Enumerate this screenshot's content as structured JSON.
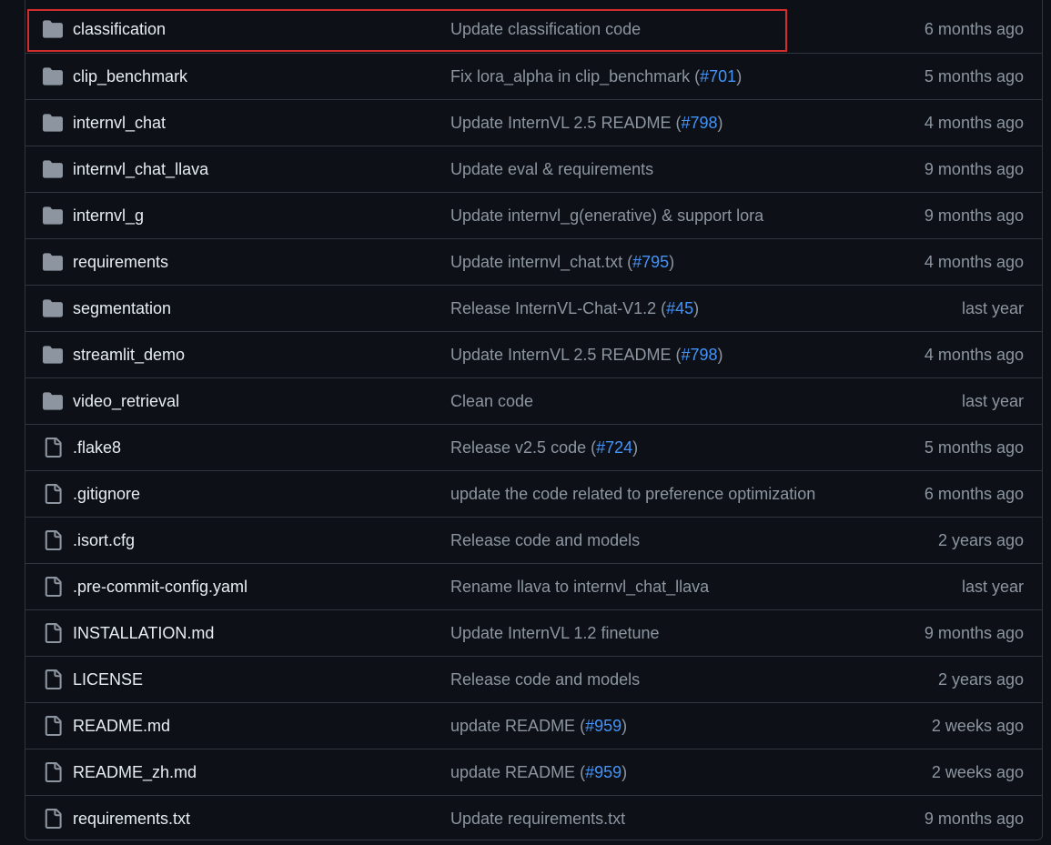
{
  "files": [
    {
      "type": "folder",
      "icon": "folder-icon",
      "name": "classification",
      "message": "Update classification code",
      "pr": "",
      "date": "6 months ago"
    },
    {
      "type": "folder",
      "icon": "folder-icon",
      "name": "clip_benchmark",
      "message": "Fix lora_alpha in clip_benchmark (",
      "pr": "#701",
      "date": "5 months ago"
    },
    {
      "type": "folder",
      "icon": "folder-icon",
      "name": "internvl_chat",
      "message": "Update InternVL 2.5 README (",
      "pr": "#798",
      "date": "4 months ago"
    },
    {
      "type": "folder",
      "icon": "folder-icon",
      "name": "internvl_chat_llava",
      "message": "Update eval & requirements",
      "pr": "",
      "date": "9 months ago"
    },
    {
      "type": "folder",
      "icon": "folder-icon",
      "name": "internvl_g",
      "message": "Update internvl_g(enerative) & support lora",
      "pr": "",
      "date": "9 months ago"
    },
    {
      "type": "folder",
      "icon": "folder-icon",
      "name": "requirements",
      "message": "Update internvl_chat.txt (",
      "pr": "#795",
      "date": "4 months ago"
    },
    {
      "type": "folder",
      "icon": "folder-icon",
      "name": "segmentation",
      "message": "Release InternVL-Chat-V1.2 (",
      "pr": "#45",
      "date": "last year"
    },
    {
      "type": "folder",
      "icon": "folder-icon",
      "name": "streamlit_demo",
      "message": "Update InternVL 2.5 README (",
      "pr": "#798",
      "date": "4 months ago"
    },
    {
      "type": "folder",
      "icon": "folder-icon",
      "name": "video_retrieval",
      "message": "Clean code",
      "pr": "",
      "date": "last year"
    },
    {
      "type": "file",
      "icon": "file-icon",
      "name": ".flake8",
      "message": "Release v2.5 code (",
      "pr": "#724",
      "date": "5 months ago"
    },
    {
      "type": "file",
      "icon": "file-icon",
      "name": ".gitignore",
      "message": "update the code related to preference optimization",
      "pr": "",
      "date": "6 months ago"
    },
    {
      "type": "file",
      "icon": "file-icon",
      "name": ".isort.cfg",
      "message": "Release code and models",
      "pr": "",
      "date": "2 years ago"
    },
    {
      "type": "file",
      "icon": "file-icon",
      "name": ".pre-commit-config.yaml",
      "message": "Rename llava to internvl_chat_llava",
      "pr": "",
      "date": "last year"
    },
    {
      "type": "file",
      "icon": "file-icon",
      "name": "INSTALLATION.md",
      "message": "Update InternVL 1.2 finetune",
      "pr": "",
      "date": "9 months ago"
    },
    {
      "type": "file",
      "icon": "file-icon",
      "name": "LICENSE",
      "message": "Release code and models",
      "pr": "",
      "date": "2 years ago"
    },
    {
      "type": "file",
      "icon": "file-icon",
      "name": "README.md",
      "message": "update README (",
      "pr": "#959",
      "date": "2 weeks ago"
    },
    {
      "type": "file",
      "icon": "file-icon",
      "name": "README_zh.md",
      "message": "update README (",
      "pr": "#959",
      "date": "2 weeks ago"
    },
    {
      "type": "file",
      "icon": "file-icon",
      "name": "requirements.txt",
      "message": "Update requirements.txt",
      "pr": "",
      "date": "9 months ago"
    }
  ],
  "colors": {
    "background": "#0d1117",
    "border": "#30363d",
    "text_primary": "#e6edf3",
    "text_muted": "#8d96a0",
    "link": "#4493f8",
    "highlight": "#d22c2c"
  }
}
